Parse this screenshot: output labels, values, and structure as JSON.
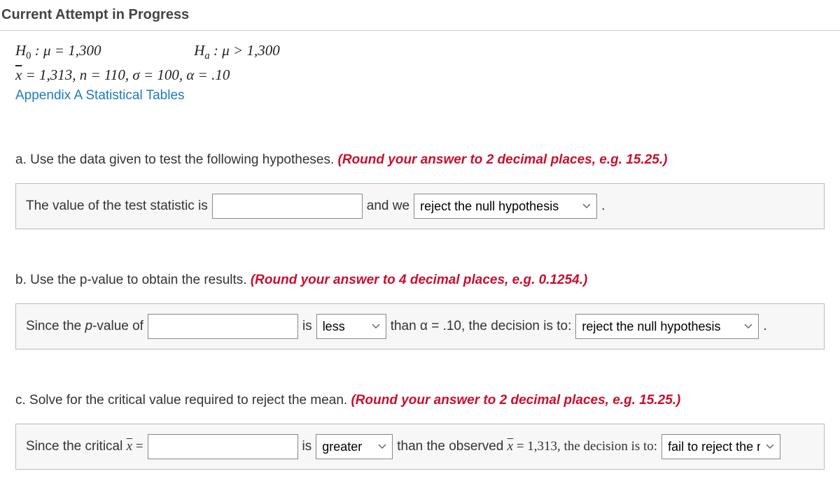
{
  "header": "Current Attempt in Progress",
  "given": {
    "h0_prefix": "H",
    "h0_sub": "0",
    "h0_rest": " : μ  =  1,300",
    "ha_prefix": "H",
    "ha_sub": "a",
    "ha_rest": " : μ  >  1,300",
    "stats_line_xbar": "x",
    "stats_line_rest": "  =  1,313,  n  =  110,  σ  =  100,  α  =  .10",
    "link": "Appendix A Statistical Tables"
  },
  "a": {
    "prompt_prefix": "a. Use the data given to test the following hypotheses. ",
    "prompt_red": "(Round your answer to 2 decimal places, e.g. 15.25.)",
    "label": "The value of the test statistic is",
    "mid": "and we",
    "select_value": "reject the null hypothesis",
    "tail": "."
  },
  "b": {
    "prompt_prefix": "b. Use the p-value to obtain the results. ",
    "prompt_red": "(Round your answer to 4 decimal places, e.g. 0.1254.)",
    "label_prefix": "Since the ",
    "label_ital": "p",
    "label_suffix": "-value of",
    "mid1": "is",
    "select1_value": "less",
    "mid2": "than α = .10, the decision is to:",
    "select2_value": "reject the null hypothesis",
    "tail": "."
  },
  "c": {
    "prompt_prefix": "c. Solve for the critical value required to reject the mean. ",
    "prompt_red": "(Round your answer to 2 decimal places, e.g. 15.25.)",
    "label_prefix": "Since the critical ",
    "label_xbar": "x",
    "label_suffix": "  =",
    "mid1": "is",
    "select1_value": "greater",
    "mid2_pre": "than the observed ",
    "mid2_xbar": "x",
    "mid2_post": "  =  1,313, the decision is to:",
    "select2_value": "fail to reject the n",
    "tail": ""
  }
}
